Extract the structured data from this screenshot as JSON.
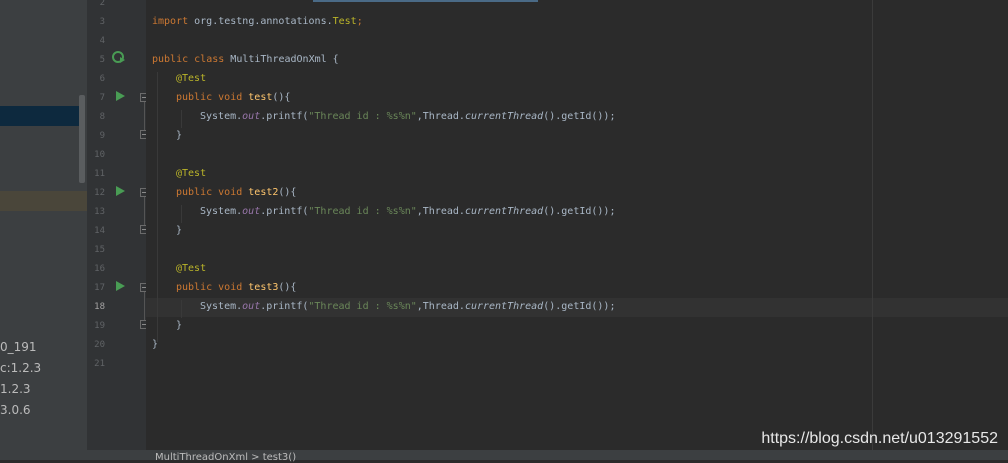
{
  "project_tree": {
    "items": [
      {
        "label": "0_191"
      },
      {
        "label": "c:1.2.3"
      },
      {
        "label": "1.2.3"
      },
      {
        "label": "3.0.6"
      }
    ]
  },
  "gutter": {
    "line_numbers": [
      "2",
      "3",
      "4",
      "5",
      "6",
      "7",
      "8",
      "9",
      "10",
      "11",
      "12",
      "13",
      "14",
      "15",
      "16",
      "17",
      "18",
      "19",
      "20",
      "21"
    ],
    "current_line": "18"
  },
  "code": {
    "import_kw": "import",
    "import_path": " org.testng.annotations.",
    "import_class": "Test",
    "semicolon": ";",
    "public_kw": "public",
    "class_kw": "class",
    "class_name": "MultiThreadOnXml",
    "open_brace": "{",
    "close_brace": "}",
    "annotation": "@Test",
    "void_kw": "void",
    "methods": [
      {
        "name": "test",
        "print_string": "\"Thread id : %s%n\""
      },
      {
        "name": "test2",
        "print_string": "\"Thread id : %s%n\""
      },
      {
        "name": "test3",
        "print_string": "\"Thread id : %s%n\""
      }
    ],
    "paren_open": "(){",
    "system": "System.",
    "out_field": "out",
    "printf_call": ".printf(",
    "comma_thread": ",Thread.",
    "current_thread": "currentThread",
    "get_id": "().getId());"
  },
  "status_bar": {
    "text": "MultiThreadOnXml  >  test3()"
  },
  "watermark": {
    "text": "https://blog.csdn.net/u013291552"
  },
  "colors": {
    "keyword": "#cc7832",
    "annotation": "#bbb529",
    "string": "#6a8759",
    "field": "#9876aa",
    "method_decl": "#ffc66d",
    "run_icon": "#499c54"
  }
}
